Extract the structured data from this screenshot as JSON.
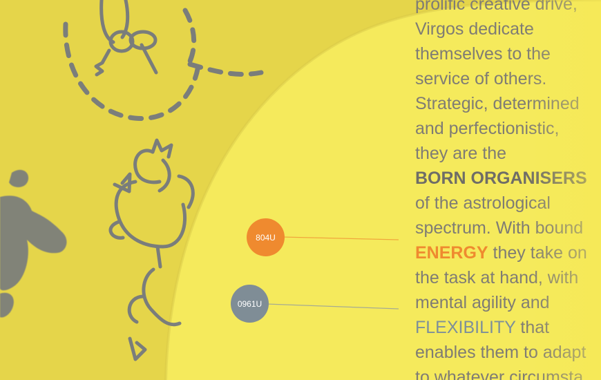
{
  "copy": {
    "lines": [
      "prolific creative drive,",
      "Virgos dedicate",
      "themselves to the",
      "service of others.",
      "Strategic, determined",
      "and perfectionistic,",
      "they are the",
      "BORN ORGANISERS",
      "of the astrological",
      "spectrum. With bound",
      "ENERGY",
      "they take on",
      "the task at hand, with",
      "mental agility and",
      "FLEXIBILITY",
      "that",
      "enables them to adapt",
      "to whatever circumsta"
    ]
  },
  "swatches": [
    {
      "label": "804U",
      "color": "#ef8a2f"
    },
    {
      "label": "0961U",
      "color": "#7f8d96"
    }
  ],
  "colors": {
    "background": "#e5d54a",
    "circle": "#f5ea5c",
    "text": "#7f7c74",
    "accent_orange": "#ef8a2f",
    "accent_blue": "#7d8f9a"
  },
  "icons": [
    "key-ring-doodle",
    "bird-doodle",
    "paint-splash"
  ]
}
